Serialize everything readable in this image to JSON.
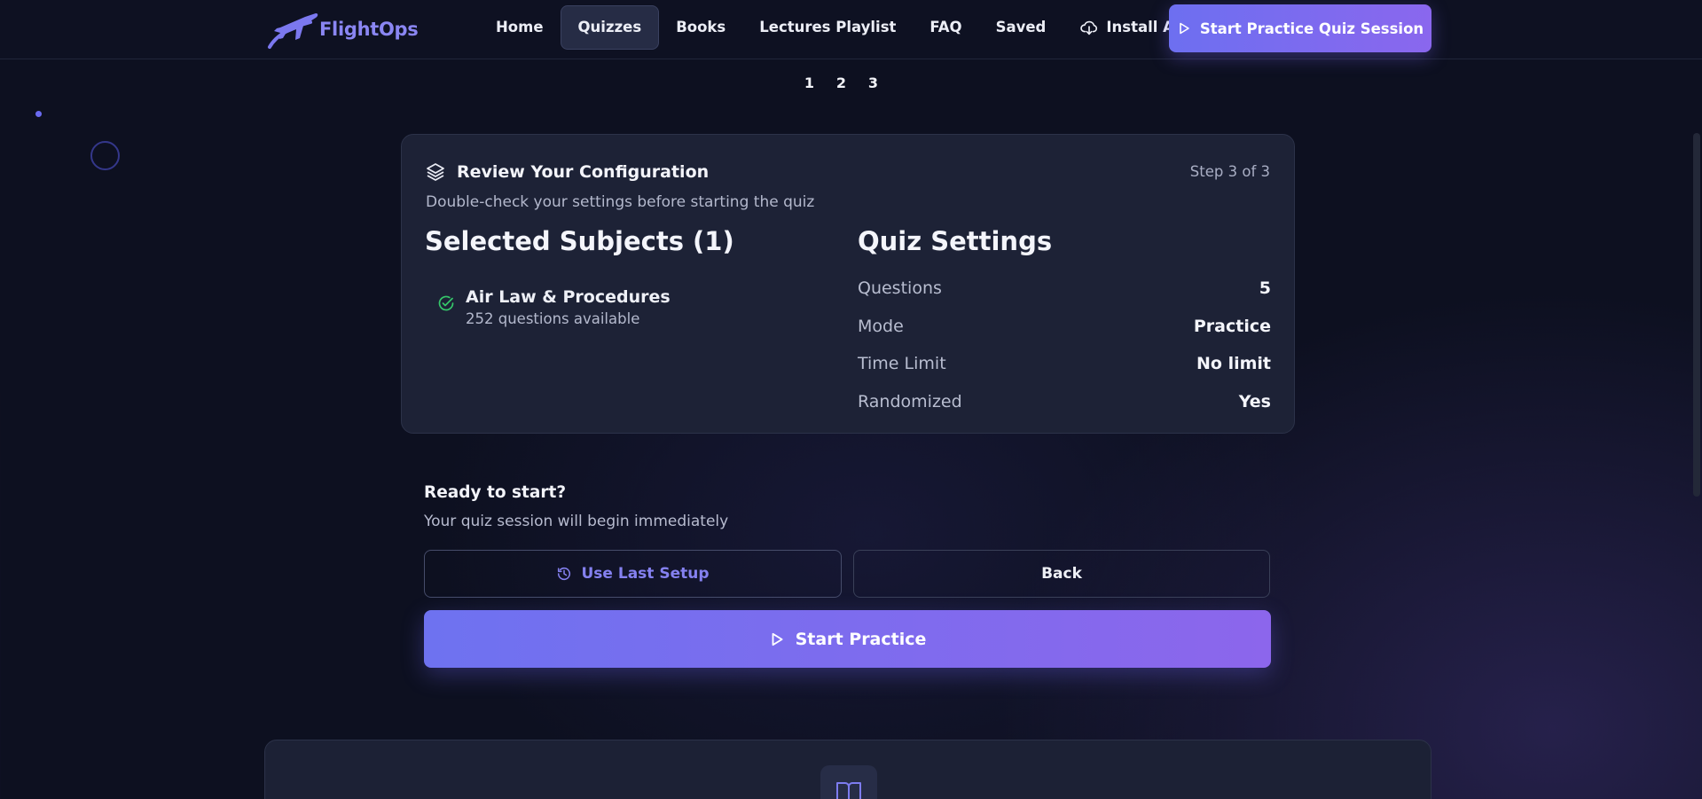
{
  "header": {
    "brand": "FlightOps",
    "nav": [
      {
        "label": "Home",
        "active": false
      },
      {
        "label": "Quizzes",
        "active": true
      },
      {
        "label": "Books",
        "active": false
      },
      {
        "label": "Lectures Playlist",
        "active": false
      },
      {
        "label": "FAQ",
        "active": false
      },
      {
        "label": "Saved",
        "active": false
      }
    ],
    "install_label": "Install App",
    "cta_label": "Start Practice Quiz Session"
  },
  "steps": [
    "1",
    "2",
    "3"
  ],
  "review": {
    "title": "Review Your Configuration",
    "step_indicator": "Step 3 of 3",
    "subtitle": "Double-check your settings before starting the quiz",
    "subjects_title": "Selected Subjects (1)",
    "subjects": [
      {
        "name": "Air Law & Procedures",
        "count": "252 questions available"
      }
    ],
    "settings_title": "Quiz Settings",
    "settings": [
      {
        "label": "Questions",
        "value": "5"
      },
      {
        "label": "Mode",
        "value": "Practice"
      },
      {
        "label": "Time Limit",
        "value": "No limit"
      },
      {
        "label": "Randomized",
        "value": "Yes"
      }
    ]
  },
  "ready": {
    "title": "Ready to start?",
    "subtitle": "Your quiz session will begin immediately",
    "use_last_label": "Use Last Setup",
    "back_label": "Back",
    "start_label": "Start Practice"
  },
  "colors": {
    "accent": "#6d6ff0",
    "accent_end": "#8a67ee",
    "background": "#0d1020",
    "card": "#1d2236",
    "success": "#35c76a"
  },
  "icons": {
    "logo": "airplane-icon",
    "install": "cloud-download-icon",
    "play": "play-icon",
    "layers": "layers-icon",
    "check": "check-circle-icon",
    "history": "history-icon",
    "book": "book-open-icon"
  }
}
